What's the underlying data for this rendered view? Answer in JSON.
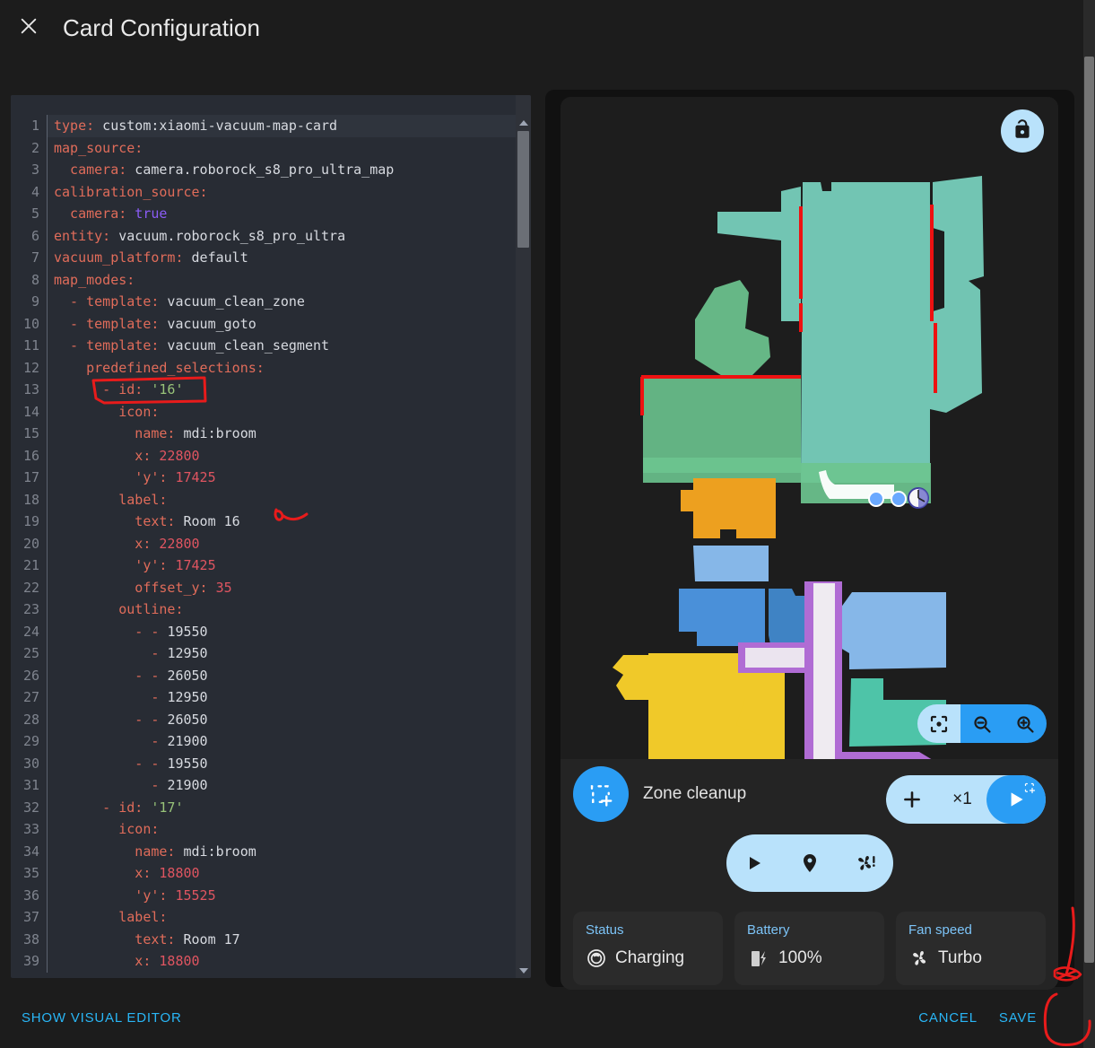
{
  "header": {
    "title": "Card Configuration",
    "close_icon": "close-icon"
  },
  "editor": {
    "language": "yaml",
    "active_line": 1,
    "lines": [
      {
        "n": 1,
        "tokens": [
          {
            "t": "type:",
            "c": "k"
          },
          {
            "t": " custom:xiaomi-vacuum-map-card",
            "c": "v"
          }
        ]
      },
      {
        "n": 2,
        "tokens": [
          {
            "t": "map_source:",
            "c": "k"
          }
        ]
      },
      {
        "n": 3,
        "tokens": [
          {
            "t": "  camera:",
            "c": "k"
          },
          {
            "t": " camera.roborock_s8_pro_ultra_map",
            "c": "v"
          }
        ]
      },
      {
        "n": 4,
        "tokens": [
          {
            "t": "calibration_source:",
            "c": "k"
          }
        ]
      },
      {
        "n": 5,
        "tokens": [
          {
            "t": "  camera:",
            "c": "k"
          },
          {
            "t": " true",
            "c": "b"
          }
        ]
      },
      {
        "n": 6,
        "tokens": [
          {
            "t": "entity:",
            "c": "k"
          },
          {
            "t": " vacuum.roborock_s8_pro_ultra",
            "c": "v"
          }
        ]
      },
      {
        "n": 7,
        "tokens": [
          {
            "t": "vacuum_platform:",
            "c": "k"
          },
          {
            "t": " default",
            "c": "v"
          }
        ]
      },
      {
        "n": 8,
        "tokens": [
          {
            "t": "map_modes:",
            "c": "k"
          }
        ]
      },
      {
        "n": 9,
        "tokens": [
          {
            "t": "  - ",
            "c": "d"
          },
          {
            "t": "template:",
            "c": "k"
          },
          {
            "t": " vacuum_clean_zone",
            "c": "v"
          }
        ]
      },
      {
        "n": 10,
        "tokens": [
          {
            "t": "  - ",
            "c": "d"
          },
          {
            "t": "template:",
            "c": "k"
          },
          {
            "t": " vacuum_goto",
            "c": "v"
          }
        ]
      },
      {
        "n": 11,
        "tokens": [
          {
            "t": "  - ",
            "c": "d"
          },
          {
            "t": "template:",
            "c": "k"
          },
          {
            "t": " vacuum_clean_segment",
            "c": "v"
          }
        ]
      },
      {
        "n": 12,
        "tokens": [
          {
            "t": "    predefined_selections:",
            "c": "k"
          }
        ]
      },
      {
        "n": 13,
        "tokens": [
          {
            "t": "      - ",
            "c": "d"
          },
          {
            "t": "id:",
            "c": "k"
          },
          {
            "t": " '16'",
            "c": "s"
          }
        ]
      },
      {
        "n": 14,
        "tokens": [
          {
            "t": "        icon:",
            "c": "k"
          }
        ]
      },
      {
        "n": 15,
        "tokens": [
          {
            "t": "          name:",
            "c": "k"
          },
          {
            "t": " mdi:broom",
            "c": "v"
          }
        ]
      },
      {
        "n": 16,
        "tokens": [
          {
            "t": "          x:",
            "c": "k"
          },
          {
            "t": " 22800",
            "c": "n"
          }
        ]
      },
      {
        "n": 17,
        "tokens": [
          {
            "t": "          'y':",
            "c": "k"
          },
          {
            "t": " 17425",
            "c": "n"
          }
        ]
      },
      {
        "n": 18,
        "tokens": [
          {
            "t": "        label:",
            "c": "k"
          }
        ]
      },
      {
        "n": 19,
        "tokens": [
          {
            "t": "          text:",
            "c": "k"
          },
          {
            "t": " Room 16",
            "c": "v"
          }
        ]
      },
      {
        "n": 20,
        "tokens": [
          {
            "t": "          x:",
            "c": "k"
          },
          {
            "t": " 22800",
            "c": "n"
          }
        ]
      },
      {
        "n": 21,
        "tokens": [
          {
            "t": "          'y':",
            "c": "k"
          },
          {
            "t": " 17425",
            "c": "n"
          }
        ]
      },
      {
        "n": 22,
        "tokens": [
          {
            "t": "          offset_y:",
            "c": "k"
          },
          {
            "t": " 35",
            "c": "n"
          }
        ]
      },
      {
        "n": 23,
        "tokens": [
          {
            "t": "        outline:",
            "c": "k"
          }
        ]
      },
      {
        "n": 24,
        "tokens": [
          {
            "t": "          - - ",
            "c": "d"
          },
          {
            "t": "19550",
            "c": "v"
          }
        ]
      },
      {
        "n": 25,
        "tokens": [
          {
            "t": "            - ",
            "c": "d"
          },
          {
            "t": "12950",
            "c": "v"
          }
        ]
      },
      {
        "n": 26,
        "tokens": [
          {
            "t": "          - - ",
            "c": "d"
          },
          {
            "t": "26050",
            "c": "v"
          }
        ]
      },
      {
        "n": 27,
        "tokens": [
          {
            "t": "            - ",
            "c": "d"
          },
          {
            "t": "12950",
            "c": "v"
          }
        ]
      },
      {
        "n": 28,
        "tokens": [
          {
            "t": "          - - ",
            "c": "d"
          },
          {
            "t": "26050",
            "c": "v"
          }
        ]
      },
      {
        "n": 29,
        "tokens": [
          {
            "t": "            - ",
            "c": "d"
          },
          {
            "t": "21900",
            "c": "v"
          }
        ]
      },
      {
        "n": 30,
        "tokens": [
          {
            "t": "          - - ",
            "c": "d"
          },
          {
            "t": "19550",
            "c": "v"
          }
        ]
      },
      {
        "n": 31,
        "tokens": [
          {
            "t": "            - ",
            "c": "d"
          },
          {
            "t": "21900",
            "c": "v"
          }
        ]
      },
      {
        "n": 32,
        "tokens": [
          {
            "t": "      - ",
            "c": "d"
          },
          {
            "t": "id:",
            "c": "k"
          },
          {
            "t": " '17'",
            "c": "s"
          }
        ]
      },
      {
        "n": 33,
        "tokens": [
          {
            "t": "        icon:",
            "c": "k"
          }
        ]
      },
      {
        "n": 34,
        "tokens": [
          {
            "t": "          name:",
            "c": "k"
          },
          {
            "t": " mdi:broom",
            "c": "v"
          }
        ]
      },
      {
        "n": 35,
        "tokens": [
          {
            "t": "          x:",
            "c": "k"
          },
          {
            "t": " 18800",
            "c": "n"
          }
        ]
      },
      {
        "n": 36,
        "tokens": [
          {
            "t": "          'y':",
            "c": "k"
          },
          {
            "t": " 15525",
            "c": "n"
          }
        ]
      },
      {
        "n": 37,
        "tokens": [
          {
            "t": "        label:",
            "c": "k"
          }
        ]
      },
      {
        "n": 38,
        "tokens": [
          {
            "t": "          text:",
            "c": "k"
          },
          {
            "t": " Room 17",
            "c": "v"
          }
        ]
      },
      {
        "n": 39,
        "tokens": [
          {
            "t": "          x:",
            "c": "k"
          },
          {
            "t": " 18800",
            "c": "n"
          }
        ]
      }
    ]
  },
  "preview": {
    "lock_icon": "unlock-icon",
    "zoom_controls": [
      {
        "icon": "center-focus-icon",
        "style": "light"
      },
      {
        "icon": "zoom-out-icon",
        "style": "bright"
      },
      {
        "icon": "zoom-in-icon",
        "style": "bright"
      }
    ],
    "mode": {
      "icon": "zone-select-icon",
      "label": "Zone cleanup",
      "plus_icon": "plus-icon",
      "repeat_count": "×1",
      "run_icon": "play-zone-icon"
    },
    "actions": [
      {
        "icon": "play-icon",
        "name": "start-button"
      },
      {
        "icon": "map-pin-icon",
        "name": "locate-button"
      },
      {
        "icon": "fan-alert-icon",
        "name": "fan-speed-button"
      }
    ],
    "tiles": [
      {
        "title": "Status",
        "value": "Charging",
        "icon": "vacuum-icon"
      },
      {
        "title": "Battery",
        "value": "100%",
        "icon": "battery-charging-icon"
      },
      {
        "title": "Fan speed",
        "value": "Turbo",
        "icon": "fan-icon"
      }
    ]
  },
  "footer": {
    "visual_editor": "SHOW VISUAL EDITOR",
    "cancel": "CANCEL",
    "save": "SAVE"
  },
  "colors": {
    "accent_blue": "#29b6f6",
    "button_blue": "#2a9df4",
    "light_blue": "#b9e2fb",
    "annotation_red": "#e81b1b",
    "editor_bg": "#282c34",
    "page_bg": "#1c1c1c"
  },
  "map_rooms": [
    {
      "color": "#79d4c0",
      "name": "room-teal-main"
    },
    {
      "color": "#6cc48f",
      "name": "room-green"
    },
    {
      "color": "#eda01f",
      "name": "room-orange"
    },
    {
      "color": "#86b7e8",
      "name": "room-lightblue"
    },
    {
      "color": "#4a90d9",
      "name": "room-blue"
    },
    {
      "color": "#f0c929",
      "name": "room-yellow"
    },
    {
      "color": "#b06cd4",
      "name": "room-purple"
    },
    {
      "color": "#4ec4a8",
      "name": "room-teal-lower"
    }
  ]
}
